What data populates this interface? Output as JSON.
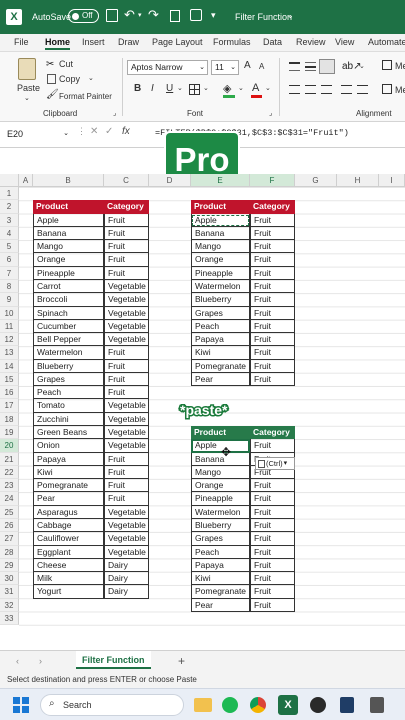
{
  "titlebar": {
    "autosave_label": "AutoSave",
    "autosave_state": "Off",
    "doc_title": "Filter Function"
  },
  "menu": [
    "File",
    "Home",
    "Insert",
    "Draw",
    "Page Layout",
    "Formulas",
    "Data",
    "Review",
    "View",
    "Automate"
  ],
  "ribbon": {
    "cut": "Cut",
    "copy": "Copy",
    "format_painter": "Format Painter",
    "paste": "Paste",
    "clipboard_group": "Clipboard",
    "font_name": "Aptos Narrow",
    "font_size": "11",
    "font_group": "Font",
    "alignment_group": "Alignment",
    "bold": "B",
    "italic": "I",
    "underline": "U",
    "grow": "A",
    "shrink": "A",
    "clip_letter": "Me"
  },
  "formulabar": {
    "name_box": "E20",
    "fx": "fx",
    "formula": "=FILTER($B$3:$C$31,$C$3:$C$31=\"Fruit\")"
  },
  "overlays": {
    "pro_badge": "Pro",
    "paste_sticker": "*paste*",
    "paste_options": "(Ctrl)"
  },
  "columns": [
    "A",
    "B",
    "C",
    "D",
    "E",
    "F",
    "G",
    "H",
    "I"
  ],
  "row_numbers": [
    "1",
    "2",
    "3",
    "4",
    "5",
    "6",
    "7",
    "8",
    "9",
    "10",
    "11",
    "12",
    "13",
    "14",
    "15",
    "16",
    "17",
    "18",
    "19",
    "20",
    "21",
    "22",
    "23",
    "24",
    "25",
    "26",
    "27",
    "28",
    "29",
    "30",
    "31",
    "32",
    "33"
  ],
  "source_table": {
    "headers": [
      "Product",
      "Category"
    ],
    "rows": [
      [
        "Apple",
        "Fruit"
      ],
      [
        "Banana",
        "Fruit"
      ],
      [
        "Mango",
        "Fruit"
      ],
      [
        "Orange",
        "Fruit"
      ],
      [
        "Pineapple",
        "Fruit"
      ],
      [
        "Carrot",
        "Vegetable"
      ],
      [
        "Broccoli",
        "Vegetable"
      ],
      [
        "Spinach",
        "Vegetable"
      ],
      [
        "Cucumber",
        "Vegetable"
      ],
      [
        "Bell Pepper",
        "Vegetable"
      ],
      [
        "Watermelon",
        "Fruit"
      ],
      [
        "Blueberry",
        "Fruit"
      ],
      [
        "Grapes",
        "Fruit"
      ],
      [
        "Peach",
        "Fruit"
      ],
      [
        "Tomato",
        "Vegetable"
      ],
      [
        "Zucchini",
        "Vegetable"
      ],
      [
        "Green Beans",
        "Vegetable"
      ],
      [
        "Onion",
        "Vegetable"
      ],
      [
        "Papaya",
        "Fruit"
      ],
      [
        "Kiwi",
        "Fruit"
      ],
      [
        "Pomegranate",
        "Fruit"
      ],
      [
        "Pear",
        "Fruit"
      ],
      [
        "Asparagus",
        "Vegetable"
      ],
      [
        "Cabbage",
        "Vegetable"
      ],
      [
        "Cauliflower",
        "Vegetable"
      ],
      [
        "Eggplant",
        "Vegetable"
      ],
      [
        "Cheese",
        "Dairy"
      ],
      [
        "Milk",
        "Dairy"
      ],
      [
        "Yogurt",
        "Dairy"
      ]
    ]
  },
  "filter_table_1": {
    "headers": [
      "Product",
      "Category"
    ],
    "rows": [
      [
        "Apple",
        "Fruit"
      ],
      [
        "Banana",
        "Fruit"
      ],
      [
        "Mango",
        "Fruit"
      ],
      [
        "Orange",
        "Fruit"
      ],
      [
        "Pineapple",
        "Fruit"
      ],
      [
        "Watermelon",
        "Fruit"
      ],
      [
        "Blueberry",
        "Fruit"
      ],
      [
        "Grapes",
        "Fruit"
      ],
      [
        "Peach",
        "Fruit"
      ],
      [
        "Papaya",
        "Fruit"
      ],
      [
        "Kiwi",
        "Fruit"
      ],
      [
        "Pomegranate",
        "Fruit"
      ],
      [
        "Pear",
        "Fruit"
      ]
    ]
  },
  "filter_table_2": {
    "headers": [
      "Product",
      "Category"
    ],
    "rows": [
      [
        "Apple",
        "Fruit"
      ],
      [
        "Banana",
        "Fruit"
      ],
      [
        "Mango",
        "Fruit"
      ],
      [
        "Orange",
        "Fruit"
      ],
      [
        "Pineapple",
        "Fruit"
      ],
      [
        "Watermelon",
        "Fruit"
      ],
      [
        "Blueberry",
        "Fruit"
      ],
      [
        "Grapes",
        "Fruit"
      ],
      [
        "Peach",
        "Fruit"
      ],
      [
        "Papaya",
        "Fruit"
      ],
      [
        "Kiwi",
        "Fruit"
      ],
      [
        "Pomegranate",
        "Fruit"
      ],
      [
        "Pear",
        "Fruit"
      ]
    ]
  },
  "sheetbar": {
    "tab": "Filter Function",
    "add": "+"
  },
  "status": "Select destination and press ENTER or choose Paste",
  "taskbar": {
    "search_placeholder": "Search"
  },
  "colors": {
    "excel_green": "#1e7145",
    "header_red": "#c0142c",
    "header_green": "#277a4a"
  }
}
